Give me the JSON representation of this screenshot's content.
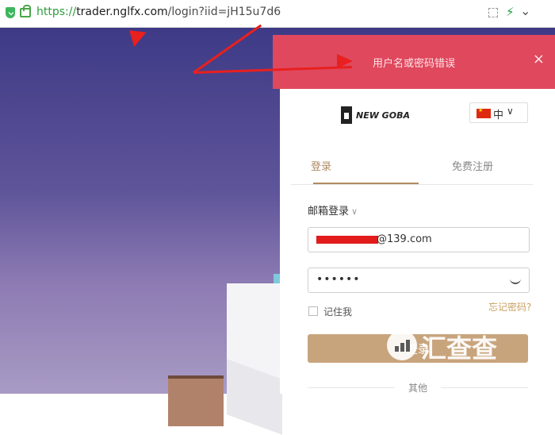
{
  "browser": {
    "url_scheme": "https://",
    "url_host": "trader.nglfx.com",
    "url_path": "/login?iid=jH15u7d6",
    "icons": [
      "shield-icon",
      "lock-icon",
      "qr-icon",
      "bolt-icon",
      "chevron-down-icon"
    ]
  },
  "alert": {
    "message": "用户名或密码错误",
    "close_symbol": "×",
    "color": "#e0485e"
  },
  "brand": {
    "name": "NEW GOBA"
  },
  "language": {
    "label": "中",
    "caret": "∨"
  },
  "tabs": {
    "login": "登录",
    "register": "免费注册"
  },
  "form": {
    "mode_label": "邮箱登录",
    "mode_caret": "∨",
    "email_suffix": "@139.com",
    "password_mask": "••••••",
    "remember_label": "记住我",
    "forgot_label": "忘记密码?",
    "submit_label": "登录",
    "other_label": "其他"
  },
  "watermark": {
    "text": "汇查查"
  },
  "colors": {
    "accent": "#b08a63",
    "button": "#c8a47d",
    "annotation_arrow": "#e8201f"
  }
}
